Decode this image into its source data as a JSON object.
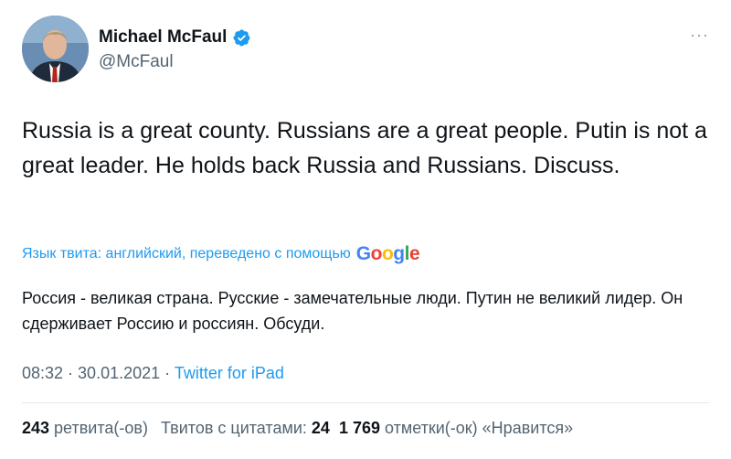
{
  "author": {
    "name": "Michael McFaul",
    "handle": "@McFaul",
    "verified": true
  },
  "more_icon": "···",
  "tweet_text": "Russia is a great county. Russians are a great people. Putin is not a great leader. He holds back Russia and Russians. Discuss.",
  "translation": {
    "label": "Язык твита: английский, переведено с помощью",
    "provider": "Google",
    "text": "Россия - великая страна. Русские - замечательные люди. Путин не великий лидер. Он сдерживает Россию и россиян. Обсуди."
  },
  "meta": {
    "time": "08:32",
    "sep1": " · ",
    "date": "30.01.2021",
    "sep2": " · ",
    "source": "Twitter for iPad"
  },
  "stats": {
    "retweets_count": "243",
    "retweets_label": " ретвита(-ов)",
    "quotes_label": "Твитов с цитатами: ",
    "quotes_count": "24",
    "likes_count": "1 769",
    "likes_label": " отметки(-ок) «Нравится»"
  },
  "colors": {
    "accent": "#1d9bf0",
    "text": "#0f1419",
    "secondary": "#536471"
  }
}
